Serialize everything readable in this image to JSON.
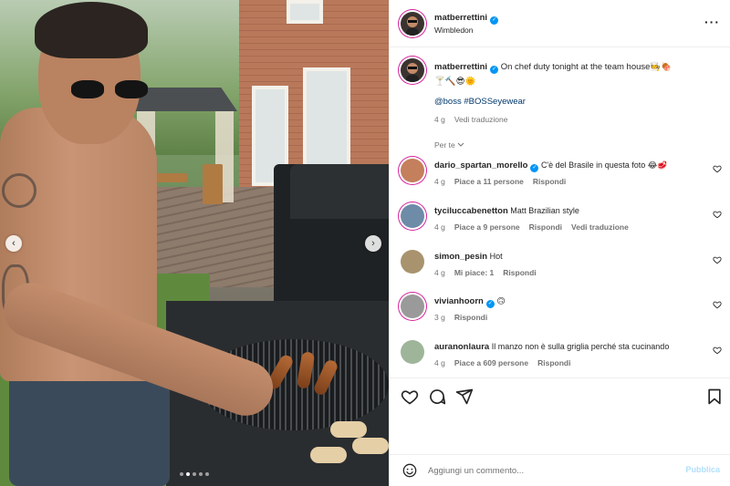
{
  "post": {
    "username": "matberrettini",
    "location": "Wimbledon",
    "caption": "On chef duty tonight at the team house🧑‍🍳🍖",
    "caption_line2": "🍸🔨😎🌞",
    "hashtags": "@boss #BOSSeyewear",
    "time": "4 g",
    "translate": "Vedi traduzione"
  },
  "comments_section": {
    "label": "Per te",
    "chevron": "chevron-down-icon"
  },
  "comments": [
    {
      "username": "dario_spartan_morello",
      "verified": true,
      "text": "C'è del Brasile in questa foto 😂🥩",
      "time": "4 g",
      "likes": "Piace a 11 persone",
      "reply": "Rispondi",
      "translate": "",
      "avatar_color": "#c47f5d"
    },
    {
      "username": "tyciluccabenetton",
      "verified": false,
      "text": "Matt Brazilian style",
      "time": "4 g",
      "likes": "Piace a 9 persone",
      "reply": "Rispondi",
      "translate": "Vedi traduzione",
      "avatar_color": "#6e8ba8"
    },
    {
      "username": "simon_pesin",
      "verified": false,
      "text": "Hot",
      "time": "4 g",
      "likes": "Mi piace: 1",
      "reply": "Rispondi",
      "translate": "",
      "avatar_color": "#a8936e"
    },
    {
      "username": "vivianhoorn",
      "verified": true,
      "text": "🙃",
      "time": "3 g",
      "likes": "",
      "reply": "Rispondi",
      "translate": "",
      "avatar_color": "#9a9a9a"
    },
    {
      "username": "auranonlaura",
      "verified": false,
      "text": "Il manzo non è sulla griglia perché sta cucinando",
      "time": "4 g",
      "likes": "Piace a 609 persone",
      "reply": "Rispondi",
      "translate": "",
      "avatar_color": "#9fb59a"
    }
  ],
  "actions": {
    "like": "heart-icon",
    "comment": "comment-icon",
    "share": "share-icon",
    "save": "bookmark-icon"
  },
  "composer": {
    "placeholder": "Aggiungi un commento...",
    "publish": "Pubblica",
    "emoji": "smiley-icon"
  },
  "carousel": {
    "current_index": 2,
    "total": 5,
    "prev": "chevron-left-icon",
    "next": "chevron-right-icon"
  },
  "colors": {
    "verified": "#0095f6",
    "link": "#00376b",
    "publish_disabled": "#b2dffc",
    "muted": "#737373"
  }
}
